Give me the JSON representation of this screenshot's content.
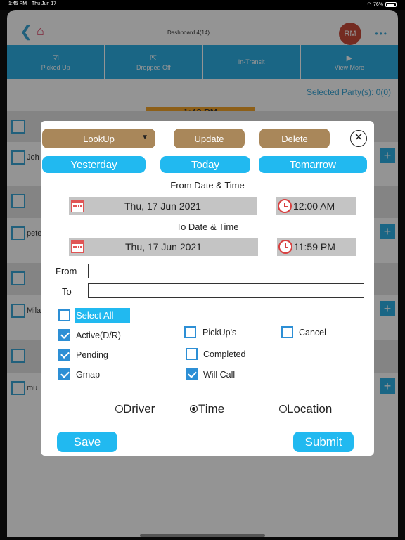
{
  "status_bar": {
    "time": "1:45 PM",
    "date": "Thu Jun 17",
    "battery": "76%"
  },
  "app": {
    "title": "Dashboard 4(14)",
    "avatar_initials": "RM",
    "tabs": [
      {
        "label": "Picked Up",
        "icon": "check-icon"
      },
      {
        "label": "Dropped Off",
        "icon": "export-icon"
      },
      {
        "label": "In-Transit",
        "icon": ""
      },
      {
        "label": "View More",
        "icon": "play-icon"
      }
    ],
    "selected_party": "Selected Party(s): 0(0)",
    "current_time": "1:42 PM",
    "rows": [
      {
        "name": "Joh"
      },
      {
        "name": "pete"
      },
      {
        "name": "Mila"
      },
      {
        "name": "mu"
      }
    ]
  },
  "modal": {
    "lookup_label": "LookUp",
    "update_label": "Update",
    "delete_label": "Delete",
    "yesterday_label": "Yesterday",
    "today_label": "Today",
    "tomorrow_label": "Tomarrow",
    "from_heading": "From Date & Time",
    "from_date": "Thu, 17 Jun 2021",
    "from_time": "12:00 AM",
    "to_heading": "To Date & Time",
    "to_date": "Thu, 17 Jun 2021",
    "to_time": "11:59 PM",
    "from_label": "From",
    "to_label": "To",
    "from_value": "",
    "to_value": "",
    "select_all_label": "Select All",
    "filters": {
      "active": {
        "label": "Active(D/R)",
        "checked": true
      },
      "pending": {
        "label": "Pending",
        "checked": true
      },
      "gmap": {
        "label": "Gmap",
        "checked": true
      },
      "pickups": {
        "label": "PickUp's",
        "checked": false
      },
      "completed": {
        "label": "Completed",
        "checked": false
      },
      "will_call": {
        "label": "Will Call",
        "checked": true
      },
      "cancel": {
        "label": "Cancel",
        "checked": false
      }
    },
    "sort_options": [
      {
        "label": "Driver",
        "selected": false
      },
      {
        "label": "Time",
        "selected": true
      },
      {
        "label": "Location",
        "selected": false
      }
    ],
    "save_label": "Save",
    "submit_label": "Submit"
  },
  "colors": {
    "accent_blue": "#21b9f0",
    "brown": "#a9875a",
    "checkbox_blue": "#2d8fd5"
  }
}
